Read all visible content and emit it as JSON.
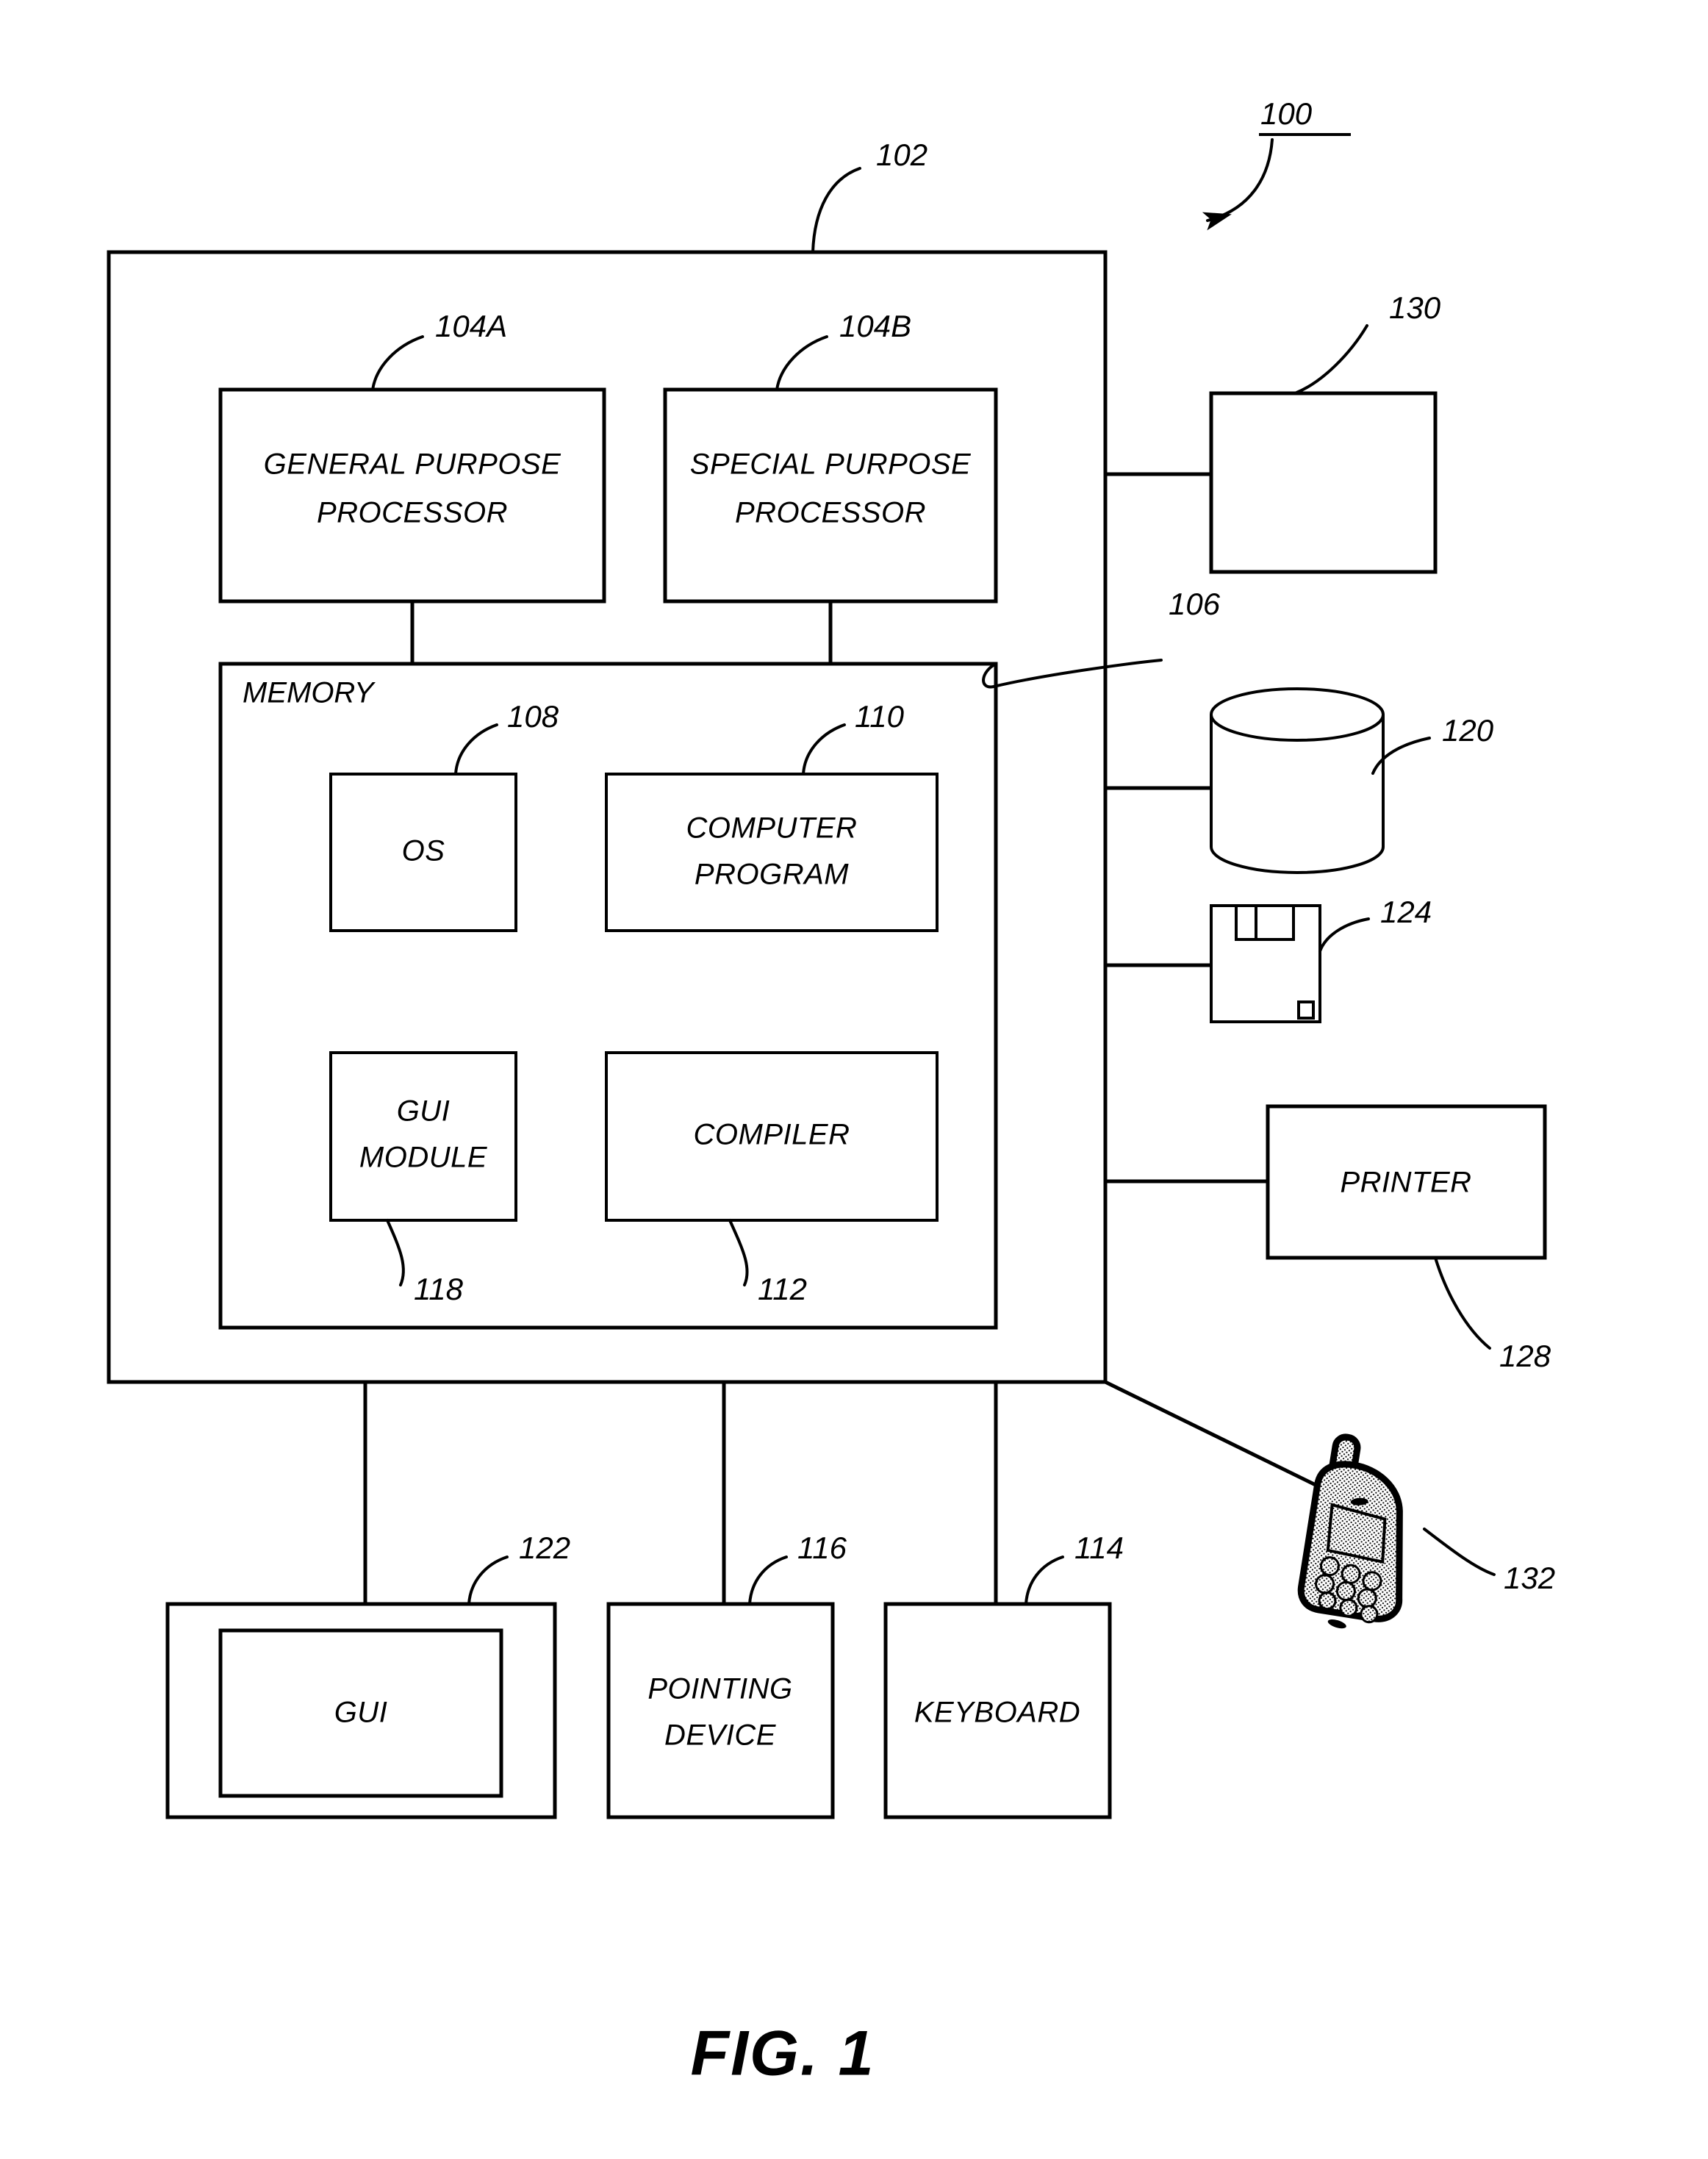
{
  "figure": {
    "caption": "FIG. 1",
    "system_ref": "100"
  },
  "computer": {
    "ref": "102",
    "memory": {
      "label": "MEMORY",
      "ref": "106",
      "modules": [
        {
          "label": "OS",
          "ref": "108"
        },
        {
          "label": "COMPUTER PROGRAM",
          "line1": "COMPUTER",
          "line2": "PROGRAM",
          "ref": "110"
        },
        {
          "label": "GUI MODULE",
          "line1": "GUI",
          "line2": "MODULE",
          "ref": "118"
        },
        {
          "label": "COMPILER",
          "ref": "112"
        }
      ]
    },
    "processors": [
      {
        "line1": "GENERAL PURPOSE",
        "line2": "PROCESSOR",
        "ref": "104A"
      },
      {
        "line1": "SPECIAL PURPOSE",
        "line2": "PROCESSOR",
        "ref": "104B"
      }
    ]
  },
  "peripherals": {
    "right": [
      {
        "name": "unlabeled-device",
        "label": "",
        "ref": "130",
        "icon": "rectangle-box"
      },
      {
        "name": "data-storage",
        "label": "",
        "ref": "120",
        "icon": "cylinder-database-icon"
      },
      {
        "name": "removable-media",
        "label": "",
        "ref": "124",
        "icon": "floppy-disk-icon"
      },
      {
        "name": "printer",
        "label": "PRINTER",
        "ref": "128",
        "icon": "printer-box"
      }
    ],
    "mobile": {
      "label": "",
      "ref": "132",
      "icon": "mobile-phone-icon"
    },
    "bottom": [
      {
        "name": "display",
        "label": "GUI",
        "ref": "122",
        "icon": "monitor-icon"
      },
      {
        "name": "pointing-device",
        "line1": "POINTING",
        "line2": "DEVICE",
        "label": "POINTING DEVICE",
        "ref": "116"
      },
      {
        "name": "keyboard",
        "label": "KEYBOARD",
        "ref": "114"
      }
    ]
  },
  "colors": {
    "stroke": "#000000",
    "background": "#ffffff"
  }
}
